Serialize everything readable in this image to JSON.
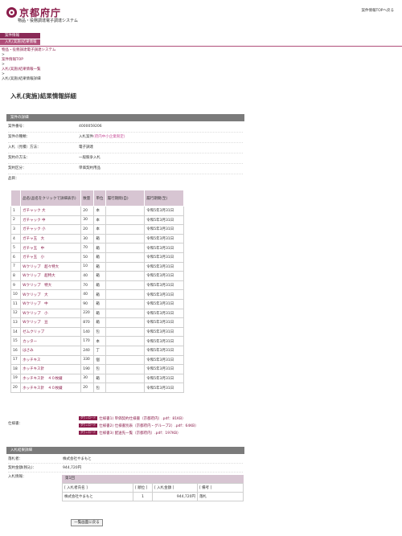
{
  "header": {
    "logo_text": "京都府庁",
    "system_name": "物品・役務調達電子調達システム",
    "top_link": "案件情報TOPへ戻る"
  },
  "menu": [
    "案件情報",
    "入札(実施)結果情報"
  ],
  "breadcrumb": {
    "items": [
      "物品・役務調達電子調達システム",
      "案件情報TOP",
      "入札(実施)結果情報一覧"
    ],
    "separator": ">",
    "current": "入札(実施)結果情報詳細"
  },
  "page_title": "入札(実施)結果情報詳細",
  "case_section": {
    "title": "案件の詳細",
    "fields": [
      {
        "label": "案件番号：",
        "value": "4000059206",
        "highlight": ""
      },
      {
        "label": "案件の種類：",
        "value": "入札案件",
        "highlight": "(府内中小企業限定)"
      },
      {
        "label": "入札（見積）方法：",
        "value": "電子調達",
        "highlight": ""
      },
      {
        "label": "契約の方法：",
        "value": "一般競争入札",
        "highlight": ""
      },
      {
        "label": "契約区分：",
        "value": "単価契約用品",
        "highlight": ""
      },
      {
        "label": "品目：",
        "value": "",
        "highlight": ""
      }
    ]
  },
  "items_table": {
    "headers": [
      "",
      "品名(品名をクリックで詳細表示)",
      "数量",
      "単位",
      "履行期間(自)",
      "履行期間(至)"
    ],
    "rows": [
      [
        "1",
        "ガチャック 大",
        "20",
        "本",
        "",
        "令和5年3月31日"
      ],
      [
        "2",
        "ガチャック 中",
        "30",
        "本",
        "",
        "令和5年3月31日"
      ],
      [
        "3",
        "ガチャック 小",
        "20",
        "本",
        "",
        "令和5年3月31日"
      ],
      [
        "4",
        "ガチャ玉　大",
        "30",
        "箱",
        "",
        "令和5年3月31日"
      ],
      [
        "5",
        "ガチャ玉　中",
        "70",
        "箱",
        "",
        "令和5年3月31日"
      ],
      [
        "6",
        "ガチャ玉　小",
        "50",
        "箱",
        "",
        "令和5年3月31日"
      ],
      [
        "7",
        "Wクリップ　超々特大",
        "10",
        "箱",
        "",
        "令和5年3月31日"
      ],
      [
        "8",
        "Wクリップ　超特大",
        "40",
        "箱",
        "",
        "令和5年3月31日"
      ],
      [
        "9",
        "Wクリップ　特大",
        "70",
        "箱",
        "",
        "令和5年3月31日"
      ],
      [
        "10",
        "Wクリップ　大",
        "40",
        "箱",
        "",
        "令和5年3月31日"
      ],
      [
        "11",
        "Wクリップ　中",
        "90",
        "箱",
        "",
        "令和5年3月31日"
      ],
      [
        "12",
        "Wクリップ　小",
        "220",
        "箱",
        "",
        "令和5年3月31日"
      ],
      [
        "13",
        "Wクリップ　豆",
        "870",
        "箱",
        "",
        "令和5年3月31日"
      ],
      [
        "14",
        "ゼムクリップ",
        "140",
        "包",
        "",
        "令和5年3月31日"
      ],
      [
        "15",
        "カッター",
        "170",
        "本",
        "",
        "令和5年3月31日"
      ],
      [
        "16",
        "はさみ",
        "240",
        "丁",
        "",
        "令和5年3月31日"
      ],
      [
        "17",
        "ホッチキス",
        "330",
        "個",
        "",
        "令和5年3月31日"
      ],
      [
        "18",
        "ホッチキス針",
        "190",
        "包",
        "",
        "令和5年3月31日"
      ],
      [
        "19",
        "ホッチキス針　４０枚綴",
        "30",
        "箱",
        "",
        "令和5年3月31日"
      ],
      [
        "20",
        "ホッチキス針　４０枚綴",
        "20",
        "包",
        "",
        "令和5年3月31日"
      ]
    ]
  },
  "spec": {
    "label": "仕様書：",
    "badge": "ダウンロード",
    "docs": [
      "仕様書1) 単価契約仕様書（京都府内）.pdf：81KB）",
      "仕様書2) 仕様書別表（京都府内・グループ2）.pdf：64KB）",
      "仕様書3) 配送先一覧（京都府内）.pdf：197KB）"
    ]
  },
  "result_section": {
    "title": "入札結果詳細",
    "winner_label": "落札者：",
    "winner_value": "株式会社やまもと",
    "amount_label": "契約金額(税込)：",
    "amount_value": "944,720円",
    "bid_label": "入札情報："
  },
  "bid_info": {
    "round": "第1回",
    "headers": [
      "[ 入札者氏名 ]",
      "[ 順位 ]",
      "[ 入札金額 ]",
      "[ 備考 ]"
    ],
    "rows": [
      [
        "株式会社やまもと",
        "1",
        "944,720円",
        "落札"
      ]
    ]
  },
  "back_button": "一覧画面に戻る",
  "colors": {
    "accent": "#8a1c4a",
    "menu": "#8a2a57",
    "section_bar": "#7b7b7b",
    "table_head": "#d7c5d2"
  }
}
